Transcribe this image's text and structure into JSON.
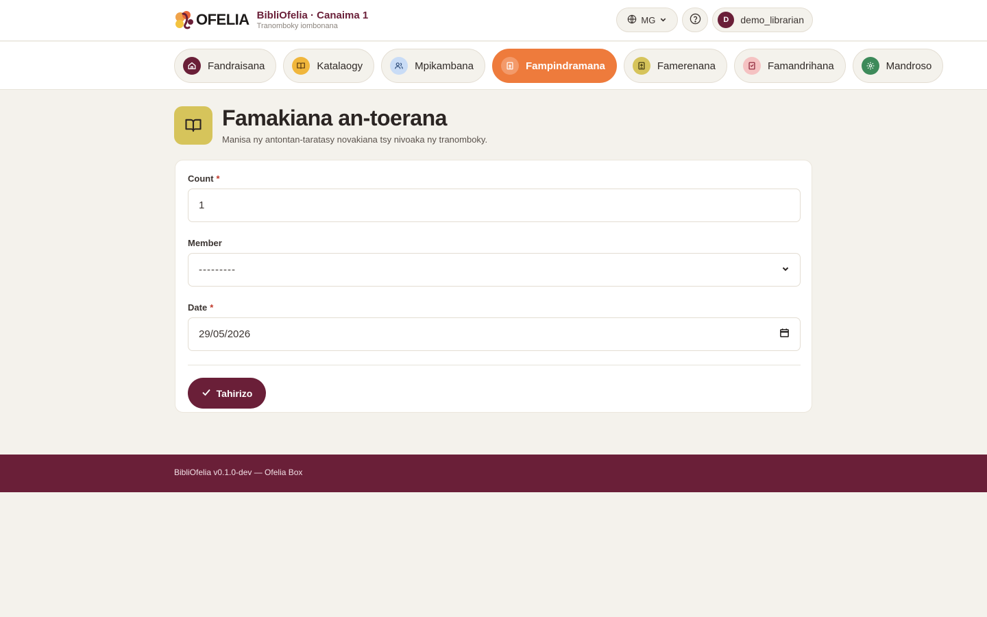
{
  "header": {
    "logo_word": "OFELIA",
    "brand_title": "BibliOfelia · Canaima 1",
    "brand_subtitle": "Tranomboky iombonana",
    "language": "MG",
    "user_initial": "D",
    "username": "demo_librarian"
  },
  "nav": {
    "items": [
      {
        "label": "Fandraisana",
        "icon": "home-icon",
        "color": "#6a1f38",
        "active": false
      },
      {
        "label": "Katalaogy",
        "icon": "book-icon",
        "color": "#f0b63c",
        "active": false
      },
      {
        "label": "Mpikambana",
        "icon": "users-icon",
        "color": "#c9dcf6",
        "active": false
      },
      {
        "label": "Fampindramana",
        "icon": "lend-icon",
        "color": "#f39a6a",
        "active": true
      },
      {
        "label": "Famerenana",
        "icon": "return-icon",
        "color": "#d6c45b",
        "active": false
      },
      {
        "label": "Famandrihana",
        "icon": "reserve-icon",
        "color": "#f5c2c2",
        "active": false
      },
      {
        "label": "Mandroso",
        "icon": "gear-icon",
        "color": "#3d8a5a",
        "active": false
      }
    ]
  },
  "page": {
    "icon": "open-book-icon",
    "title": "Famakiana an-toerana",
    "description": "Manisa ny antontan-taratasy novakiana tsy nivoaka ny tranomboky."
  },
  "form": {
    "count_label": "Count",
    "count_value": "1",
    "member_label": "Member",
    "member_value": "---------",
    "date_label": "Date",
    "date_value": "29/05/2026",
    "required_mark": "*",
    "submit_label": "Tahirizo"
  },
  "footer": {
    "text": "BibliOfelia v0.1.0-dev — Ofelia Box"
  },
  "colors": {
    "brand": "#6a1f38",
    "accent": "#ee7b3c",
    "background": "#f4f2ec"
  }
}
